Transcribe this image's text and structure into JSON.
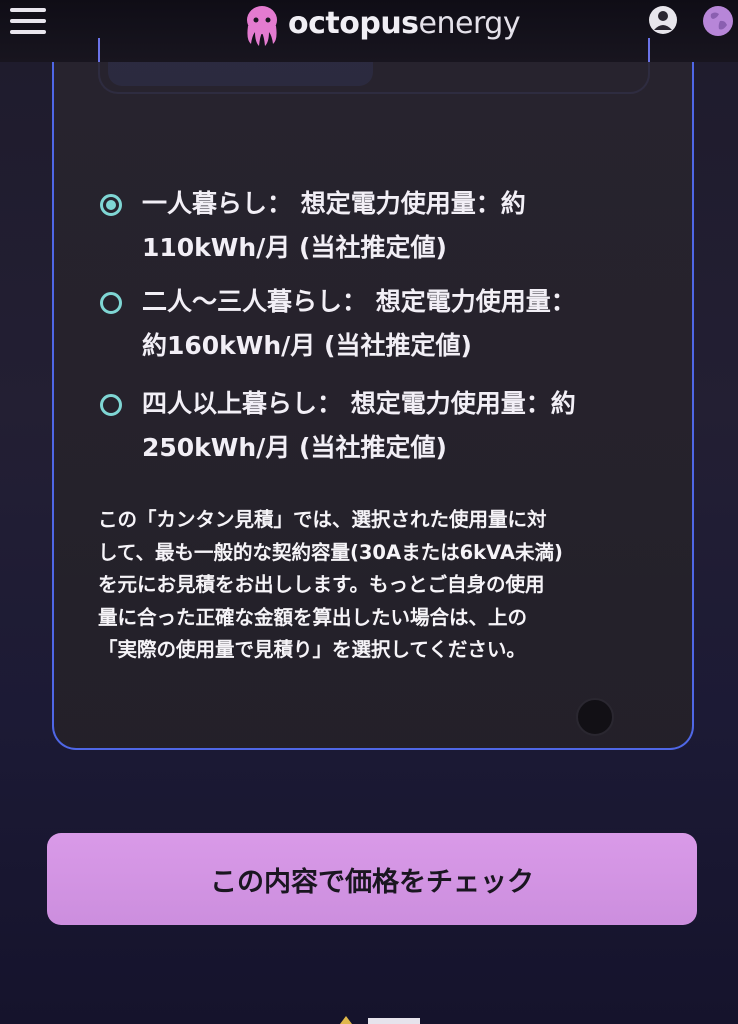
{
  "header": {
    "brand_bold": "octopus",
    "brand_light": "energy",
    "icons": [
      "menu-icon",
      "octopus-logo-icon",
      "user-icon",
      "globe-icon"
    ]
  },
  "options": [
    {
      "label": "一人暮らし： 想定電力使用量：約110kWh/月 (当社推定値)",
      "selected": true
    },
    {
      "label": "二人〜三人暮らし： 想定電力使用量：約160kWh/月 (当社推定値)",
      "selected": false
    },
    {
      "label": "四人以上暮らし： 想定電力使用量：約250kWh/月 (当社推定値)",
      "selected": false
    }
  ],
  "option_lines": [
    [
      "一人暮らし： 想定電力使用量：約",
      "110kWh/月 (当社推定値)"
    ],
    [
      "二人〜三人暮らし： 想定電力使用量：",
      "約160kWh/月 (当社推定値)"
    ],
    [
      "四人以上暮らし： 想定電力使用量：約",
      "250kWh/月 (当社推定値)"
    ]
  ],
  "note_lines": [
    "この「カンタン見積」では、選択された使用量に対",
    "して、最も一般的な契約容量(30Aまたは6kVA未満)",
    "を元にお見積をお出しします。もっとご自身の使用",
    "量に合った正確な金額を算出したい場合は、上の",
    "「実際の使用量で見積り」を選択してください。"
  ],
  "cta": {
    "label": "この内容で価格をチェック"
  },
  "colors": {
    "accent_blue": "#4f67e6",
    "radio_teal": "#7fd6d4",
    "button_pink": "#d99ae8",
    "logo_pink": "#e47bd0"
  }
}
